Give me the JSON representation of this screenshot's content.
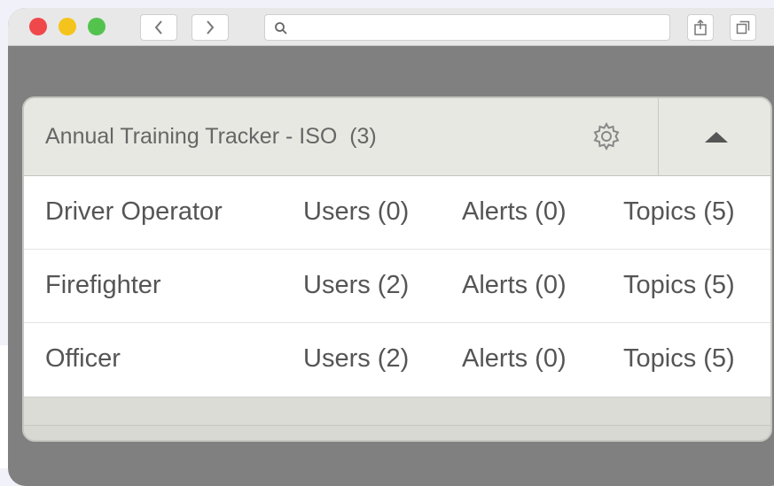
{
  "browser": {
    "address_value": "",
    "icons": {
      "back": "chevron-left-icon",
      "forward": "chevron-right-icon",
      "search": "search-icon",
      "share": "share-icon",
      "tabs": "tabs-icon"
    },
    "traffic_lights": {
      "close": "#f0484a",
      "minimize": "#f5c41c",
      "zoom": "#54c34e"
    }
  },
  "panel": {
    "title": "Annual Training Tracker - ISO  (3)",
    "settings_icon": "gear-icon",
    "collapse_icon": "triangle-up-icon"
  },
  "rows": [
    {
      "name": "Driver Operator",
      "users": "Users (0)",
      "alerts": "Alerts (0)",
      "topics": "Topics (5)"
    },
    {
      "name": "Firefighter",
      "users": "Users (2)",
      "alerts": "Alerts (0)",
      "topics": "Topics (5)"
    },
    {
      "name": "Officer",
      "users": "Users (2)",
      "alerts": "Alerts (0)",
      "topics": "Topics (5)"
    }
  ],
  "colors": {
    "page_background": "#f1f1f9",
    "window_frame": "#808080",
    "header_background": "#e8e8e2",
    "text": "#555555"
  }
}
